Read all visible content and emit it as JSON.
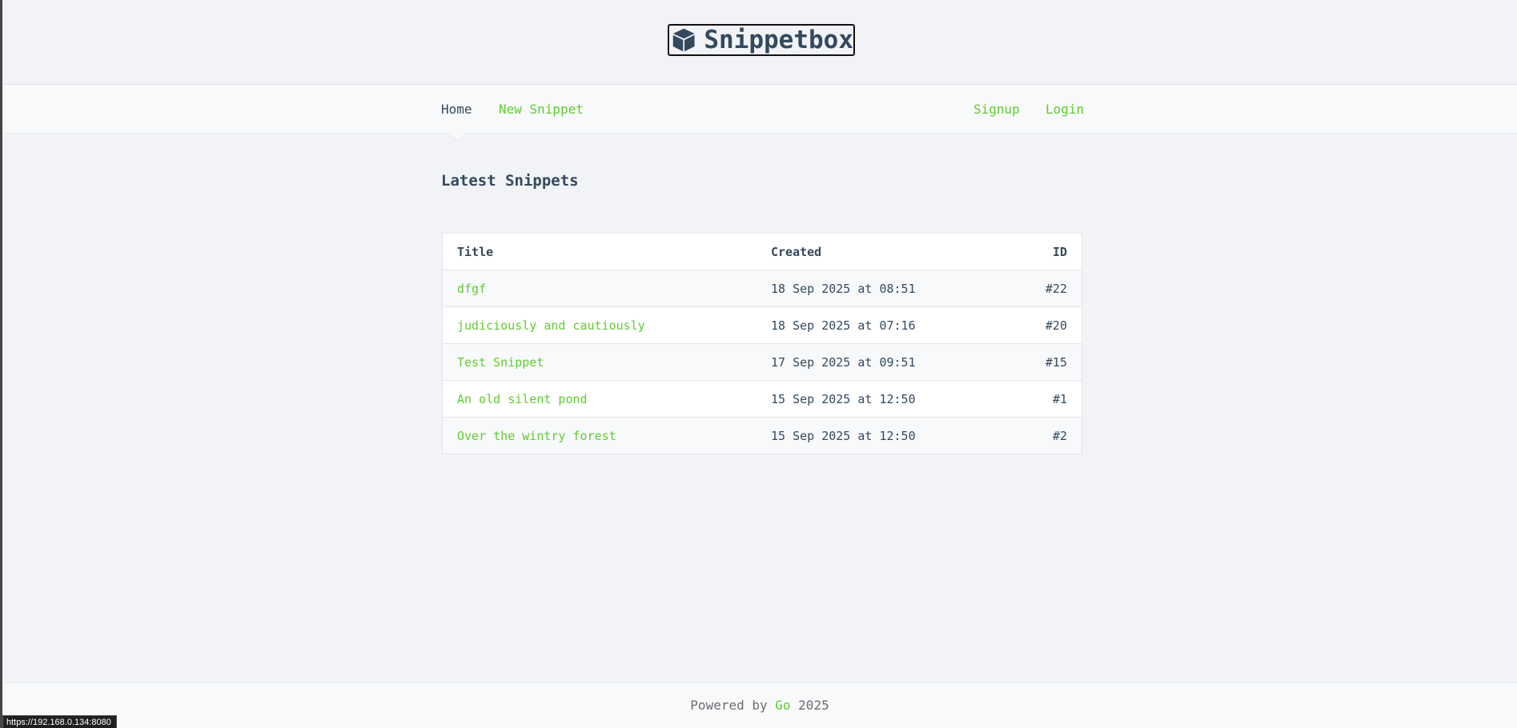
{
  "header": {
    "title": "Snippetbox"
  },
  "nav": {
    "home": "Home",
    "new_snippet": "New Snippet",
    "signup": "Signup",
    "login": "Login"
  },
  "main": {
    "heading": "Latest Snippets",
    "columns": {
      "title": "Title",
      "created": "Created",
      "id": "ID"
    },
    "rows": [
      {
        "title": "dfgf",
        "created": "18 Sep 2025 at 08:51",
        "id": "#22"
      },
      {
        "title": "judiciously and cautiously",
        "created": "18 Sep 2025 at 07:16",
        "id": "#20"
      },
      {
        "title": "Test Snippet",
        "created": "17 Sep 2025 at 09:51",
        "id": "#15"
      },
      {
        "title": "An old silent pond",
        "created": "15 Sep 2025 at 12:50",
        "id": "#1"
      },
      {
        "title": "Over the wintry forest",
        "created": "15 Sep 2025 at 12:50",
        "id": "#2"
      }
    ]
  },
  "footer": {
    "prefix": "Powered by",
    "link": "Go",
    "year": "2025"
  },
  "status_bar": {
    "url": "https://192.168.0.134:8080"
  },
  "colors": {
    "accent": "#62cb31",
    "text": "#34495e",
    "background": "#f1f3f6"
  }
}
